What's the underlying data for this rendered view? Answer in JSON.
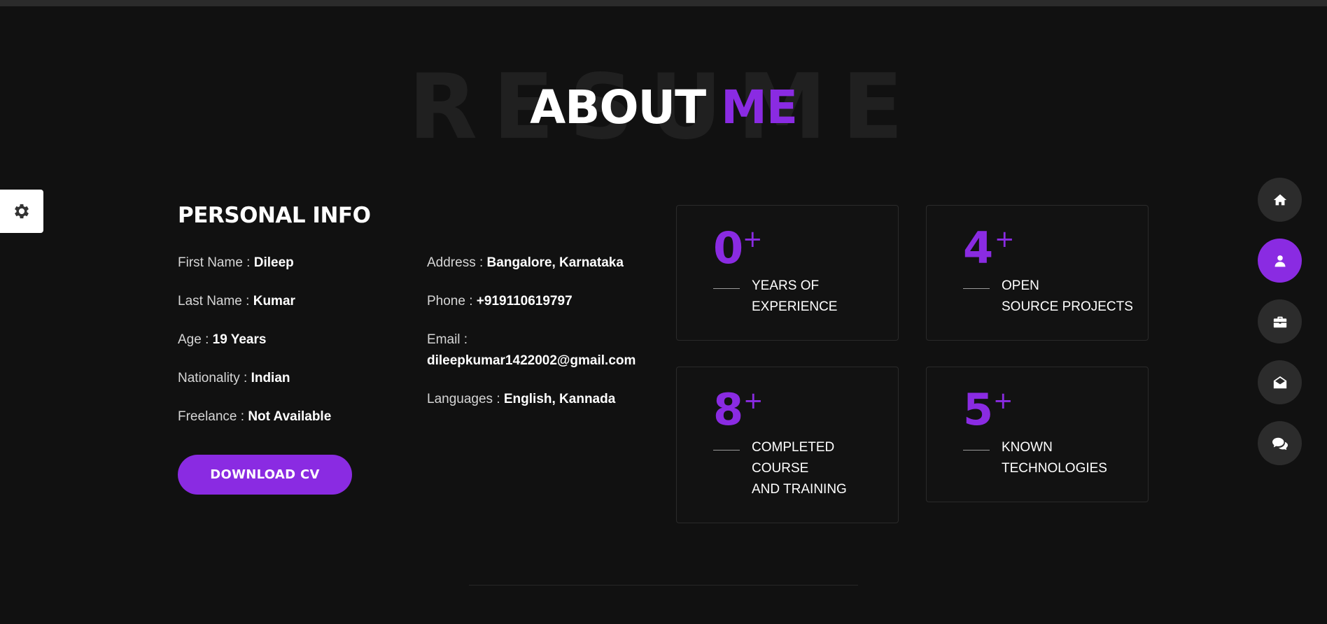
{
  "section": {
    "bg_title": "RESUME",
    "title_part1": "ABOUT",
    "title_part2": "ME"
  },
  "personal_info": {
    "heading": "PERSONAL INFO",
    "left": [
      {
        "label": "First Name :",
        "value": "Dileep"
      },
      {
        "label": "Last Name :",
        "value": "Kumar"
      },
      {
        "label": "Age :",
        "value": "19 Years"
      },
      {
        "label": "Nationality :",
        "value": "Indian"
      },
      {
        "label": "Freelance :",
        "value": "Not Available"
      }
    ],
    "right": [
      {
        "label": "Address :",
        "value": "Bangalore, Karnataka"
      },
      {
        "label": "Phone :",
        "value": "+919110619797"
      },
      {
        "label": "Email :",
        "value": "dileepkumar1422002@gmail.com"
      },
      {
        "label": "Languages :",
        "value": "English, Kannada"
      }
    ],
    "download_label": "DOWNLOAD CV"
  },
  "stats": [
    {
      "number": "0",
      "plus": "+",
      "label": "YEARS OF\nEXPERIENCE"
    },
    {
      "number": "4",
      "plus": "+",
      "label": "OPEN\nSOURCE PROJECTS"
    },
    {
      "number": "8",
      "plus": "+",
      "label": "COMPLETED\nCOURSE\nAND TRAINING"
    },
    {
      "number": "5",
      "plus": "+",
      "label": "KNOWN\nTECHNOLOGIES"
    }
  ],
  "nav": [
    {
      "icon": "home-icon",
      "active": false
    },
    {
      "icon": "user-icon",
      "active": true
    },
    {
      "icon": "briefcase-icon",
      "active": false
    },
    {
      "icon": "envelope-open-icon",
      "active": false
    },
    {
      "icon": "comments-icon",
      "active": false
    }
  ],
  "colors": {
    "accent": "#8a2be2",
    "background": "#111111"
  }
}
